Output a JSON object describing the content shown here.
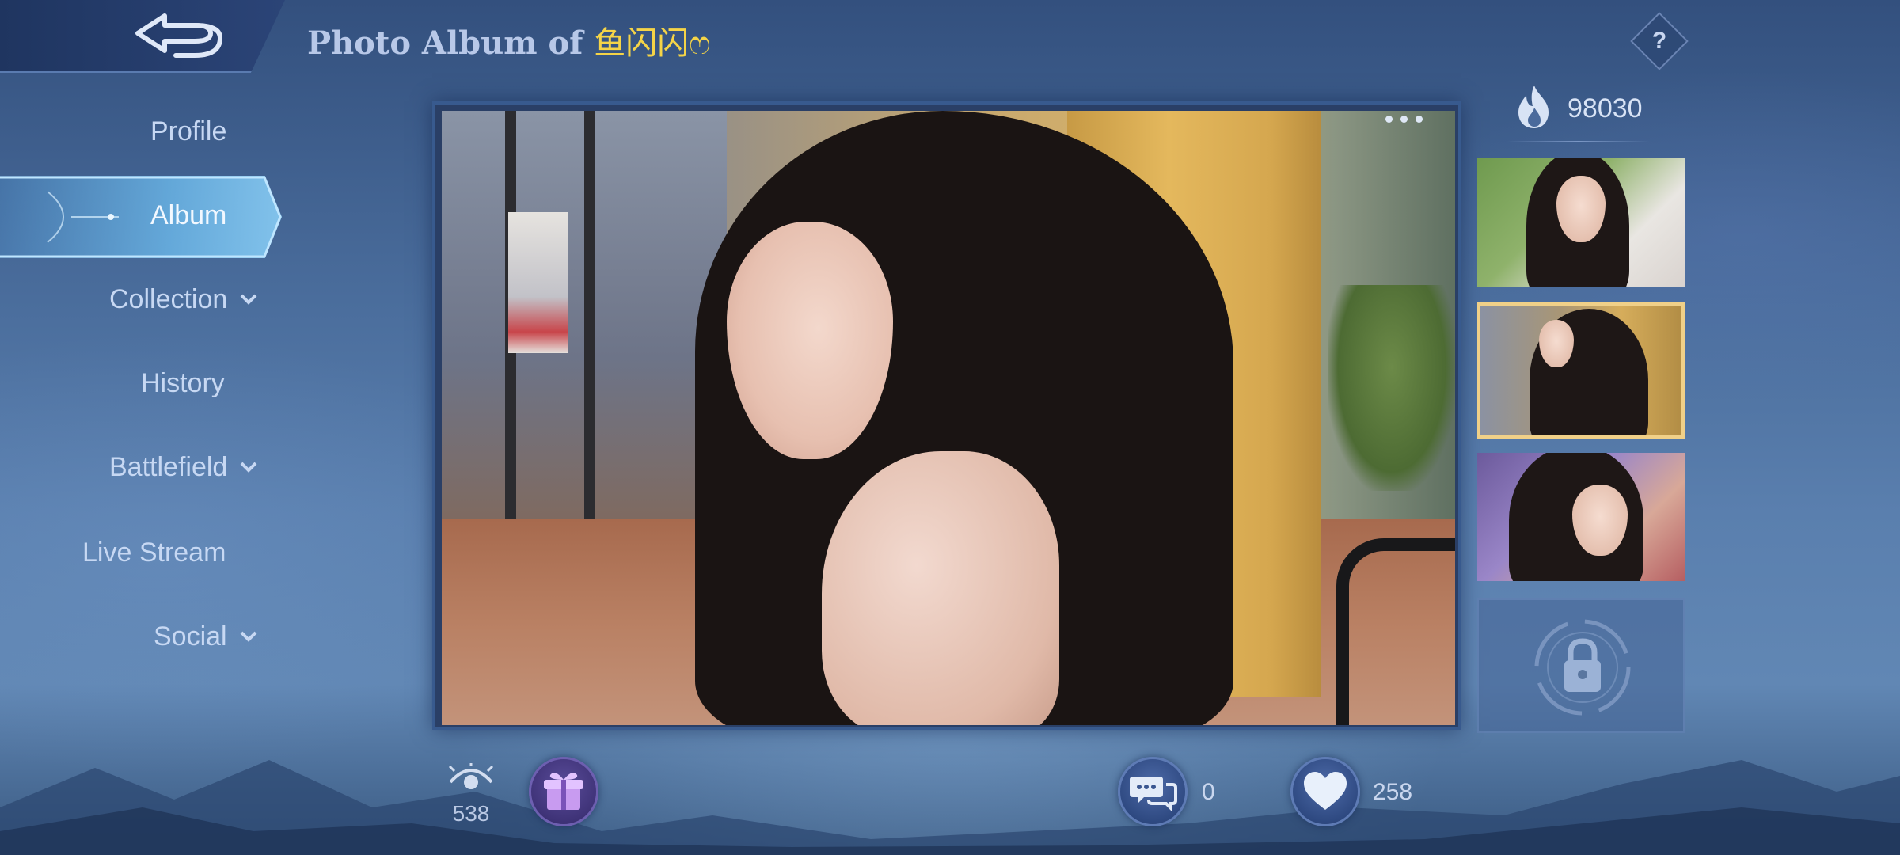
{
  "header": {
    "title_prefix": "Photo Album of",
    "owner_name": "鱼闪闪ෆ",
    "help_label": "?"
  },
  "sidebar": {
    "items": [
      {
        "label": "Profile",
        "has_dropdown": false,
        "active": false
      },
      {
        "label": "Album",
        "has_dropdown": false,
        "active": true
      },
      {
        "label": "Collection",
        "has_dropdown": true,
        "active": false
      },
      {
        "label": "History",
        "has_dropdown": false,
        "active": false
      },
      {
        "label": "Battlefield",
        "has_dropdown": true,
        "active": false
      },
      {
        "label": "Live Stream",
        "has_dropdown": false,
        "active": false
      },
      {
        "label": "Social",
        "has_dropdown": true,
        "active": false
      }
    ]
  },
  "popularity": {
    "icon": "flame-icon",
    "value": "98030"
  },
  "thumbnails": [
    {
      "selected": false,
      "locked": false
    },
    {
      "selected": true,
      "locked": false
    },
    {
      "selected": false,
      "locked": false
    },
    {
      "selected": false,
      "locked": true,
      "icon": "lock-icon"
    }
  ],
  "stats": {
    "views": "538",
    "comments": "0",
    "likes": "258"
  },
  "colors": {
    "accent_gold": "#f5d447",
    "selected_border": "#f0d088",
    "active_nav": "#8fd0f5"
  }
}
